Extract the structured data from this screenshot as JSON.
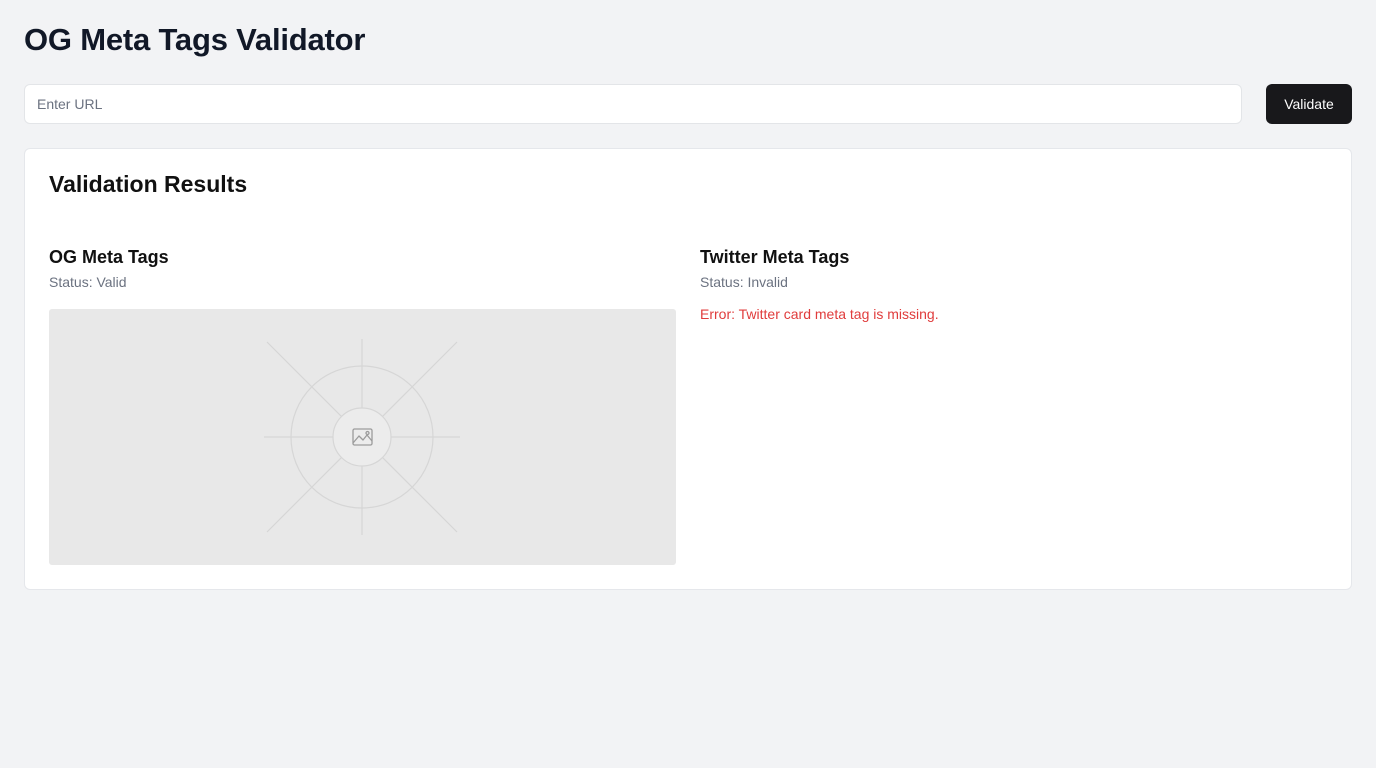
{
  "header": {
    "title": "OG Meta Tags Validator"
  },
  "form": {
    "url_value": "",
    "url_placeholder": "Enter URL",
    "validate_label": "Validate"
  },
  "results": {
    "title": "Validation Results",
    "og": {
      "title": "OG Meta Tags",
      "status_prefix": "Status: ",
      "status_value": "Valid",
      "preview_icon": "image-placeholder-icon"
    },
    "twitter": {
      "title": "Twitter Meta Tags",
      "status_prefix": "Status: ",
      "status_value": "Invalid",
      "error": "Error: Twitter card meta tag is missing."
    }
  },
  "colors": {
    "background": "#f2f3f5",
    "primary_button": "#18181b",
    "error": "#e03c3c",
    "muted_text": "#6b7280"
  }
}
